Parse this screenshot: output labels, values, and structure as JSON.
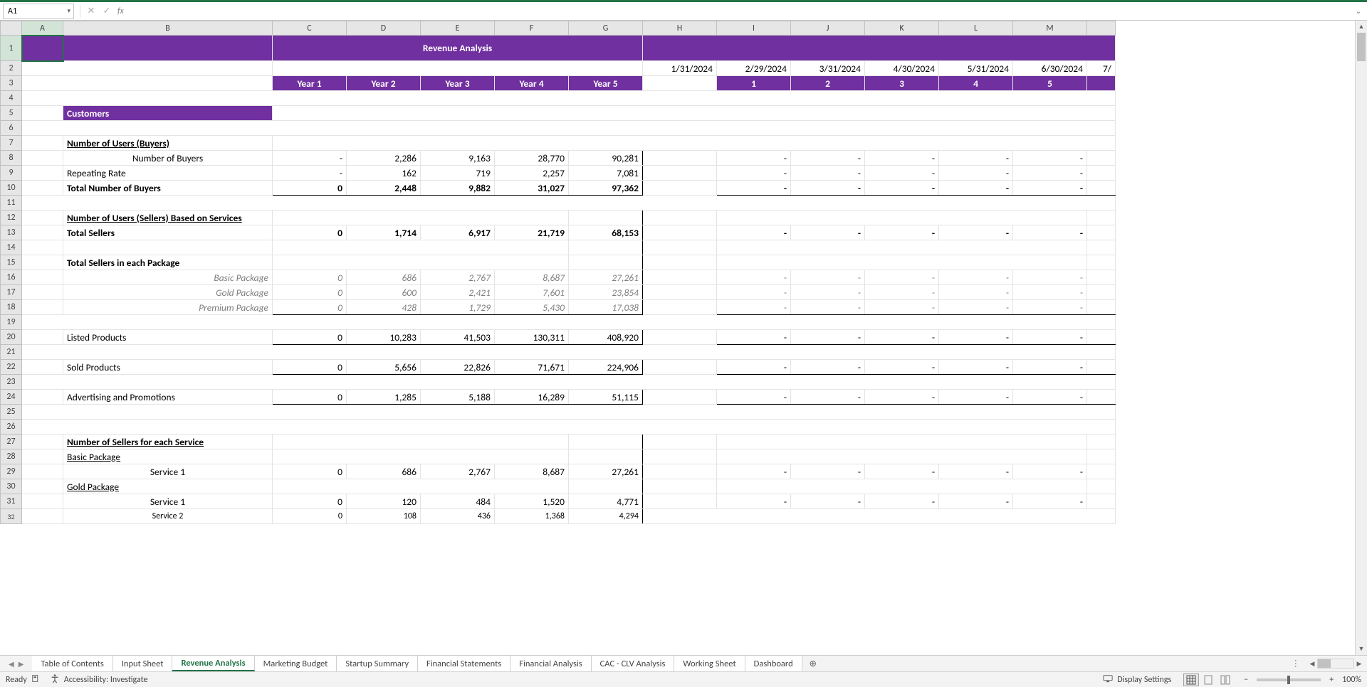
{
  "nameBox": "A1",
  "formulaBar": "",
  "columns": [
    "A",
    "B",
    "C",
    "D",
    "E",
    "F",
    "G",
    "H",
    "I",
    "J",
    "K",
    "L",
    "M"
  ],
  "title": "Revenue Analysis",
  "dates": {
    "H": "1/31/2024",
    "I": "2/29/2024",
    "J": "3/31/2024",
    "K": "4/30/2024",
    "L": "5/31/2024",
    "M": "6/30/2024",
    "N": "7/"
  },
  "yearHeaders": [
    "Year 1",
    "Year 2",
    "Year 3",
    "Year 4",
    "Year 5"
  ],
  "monthNums": [
    "1",
    "2",
    "3",
    "4",
    "5"
  ],
  "section_customers": "Customers",
  "labels": {
    "numBuyersHeader": "Number of Users (Buyers)",
    "numBuyers": "Number of Buyers",
    "repeatingRate": "Repeating Rate",
    "totalBuyers": "Total Number of Buyers",
    "numSellersHeader": "Number of Users (Sellers) Based on Services",
    "totalSellers": "Total Sellers",
    "totalSellersPkg": "Total Sellers in each Package",
    "basicPkg": "Basic Package",
    "goldPkg": "Gold Package",
    "premiumPkg": "Premium Package",
    "listed": "Listed Products",
    "sold": "Sold Products",
    "adv": "Advertising and Promotions",
    "numSellersService": "Number of Sellers for each Service",
    "basicPkgU": "Basic Package",
    "goldPkgU": "Gold Package",
    "service1": "Service 1",
    "service1b": "Service 1",
    "service2": "Service 2"
  },
  "chart_data": {
    "type": "table",
    "years": {
      "numBuyers": [
        "-",
        "2,286",
        "9,163",
        "28,770",
        "90,281"
      ],
      "repeatingRate": [
        "-",
        "162",
        "719",
        "2,257",
        "7,081"
      ],
      "totalBuyers": [
        "0",
        "2,448",
        "9,882",
        "31,027",
        "97,362"
      ],
      "totalSellers": [
        "0",
        "1,714",
        "6,917",
        "21,719",
        "68,153"
      ],
      "basicPkg": [
        "0",
        "686",
        "2,767",
        "8,687",
        "27,261"
      ],
      "goldPkg": [
        "0",
        "600",
        "2,421",
        "7,601",
        "23,854"
      ],
      "premiumPkg": [
        "0",
        "428",
        "1,729",
        "5,430",
        "17,038"
      ],
      "listed": [
        "0",
        "10,283",
        "41,503",
        "130,311",
        "408,920"
      ],
      "sold": [
        "0",
        "5,656",
        "22,826",
        "71,671",
        "224,906"
      ],
      "adv": [
        "0",
        "1,285",
        "5,188",
        "16,289",
        "51,115"
      ],
      "svc1_basic": [
        "0",
        "686",
        "2,767",
        "8,687",
        "27,261"
      ],
      "svc1_gold": [
        "0",
        "120",
        "484",
        "1,520",
        "4,771"
      ],
      "svc2_gold": [
        "0",
        "108",
        "436",
        "1,368",
        "4,294"
      ]
    },
    "months_dash": [
      "-",
      "-",
      "-",
      "-",
      "-"
    ]
  },
  "tabs": [
    "Table of Contents",
    "Input Sheet",
    "Revenue Analysis",
    "Marketing Budget",
    "Startup Summary",
    "Financial Statements",
    "Financial Analysis",
    "CAC - CLV Analysis",
    "Working Sheet",
    "Dashboard"
  ],
  "activeTab": "Revenue Analysis",
  "status": {
    "ready": "Ready",
    "accessibility": "Accessibility: Investigate",
    "displaySettings": "Display Settings",
    "zoom": "100%"
  }
}
